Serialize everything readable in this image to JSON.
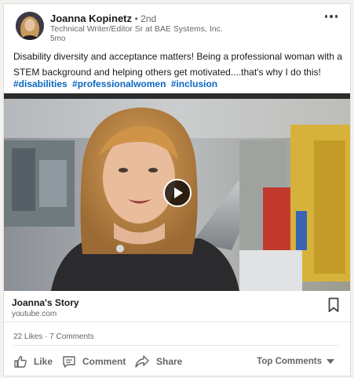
{
  "post": {
    "author": {
      "name": "Joanna Kopinetz",
      "degree": "• 2nd",
      "headline": "Technical Writer/Editor Sr at BAE Systems, Inc.",
      "time": "5mo"
    },
    "text": "Disability diversity and acceptance matters! Being a professional woman with a STEM background and helping others get motivated....that's why I do this!",
    "hashtags": [
      "#disabilities",
      "#professionalwomen",
      "#inclusion"
    ],
    "link": {
      "title": "Joanna's Story",
      "domain": "youtube.com"
    },
    "social_counts": {
      "likes": "22 Likes",
      "separator": " · ",
      "comments": "7 Comments"
    },
    "actions": {
      "like": "Like",
      "comment": "Comment",
      "share": "Share"
    },
    "sort": {
      "selected": "Top Comments"
    }
  },
  "icons": {
    "more": "more-options-icon",
    "play": "play-icon",
    "bookmark": "bookmark-icon",
    "like": "thumbs-up-icon",
    "comment": "comment-icon",
    "share": "share-arrow-icon",
    "sort": "caret-down-icon"
  },
  "colors": {
    "hashtag": "#0a66c2",
    "muted": "#666666",
    "text": "#191919"
  }
}
